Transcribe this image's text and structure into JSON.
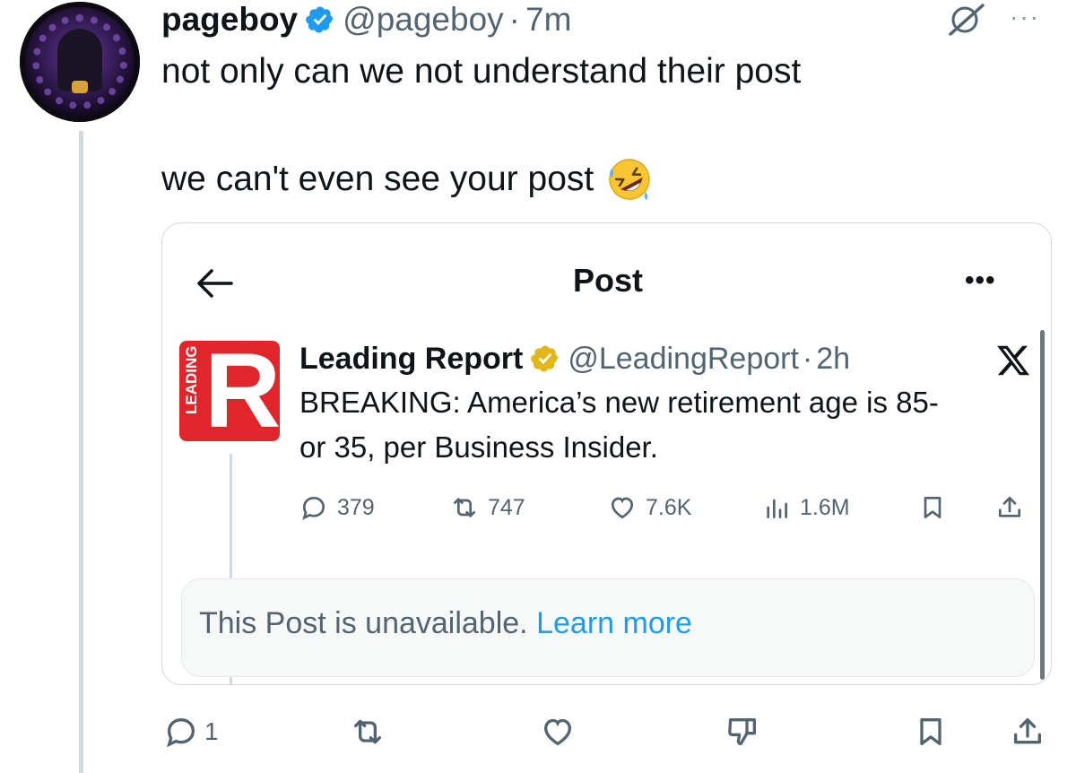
{
  "post": {
    "author_name": "pageboy",
    "author_handle": "@pageboy",
    "separator": "·",
    "time": "7m",
    "text_line1": "not only can we not understand their post",
    "text_line2": "we can't even see your post",
    "emoji_icon": "rolling-on-floor-laughing-emoji",
    "more_label": "···",
    "actions": {
      "replies": "1",
      "reposts": "",
      "likes": "",
      "dislikes": "",
      "bookmarks": "",
      "share": ""
    }
  },
  "embedded_screenshot": {
    "nav_title": "Post",
    "more_label": "•••",
    "quoted_post": {
      "author_name": "Leading Report",
      "author_handle": "@LeadingReport",
      "separator": "·",
      "time": "2h",
      "logo_letter": "R",
      "logo_text": "LEADING",
      "text_line1": "BREAKING: America’s new retirement age is 85-",
      "text_line2": "or 35, per Business Insider.",
      "stats": {
        "replies": "379",
        "reposts": "747",
        "likes": "7.6K",
        "views": "1.6M"
      }
    },
    "unavailable_text": "This Post is unavailable.",
    "learn_more": "Learn more"
  },
  "colors": {
    "text_primary": "#0f1419",
    "text_secondary": "#536471",
    "link_blue": "#1d9bf0",
    "verified_blue": "#1d9bf0",
    "gold_badge": "#e2b719",
    "logo_red": "#e0262a"
  }
}
